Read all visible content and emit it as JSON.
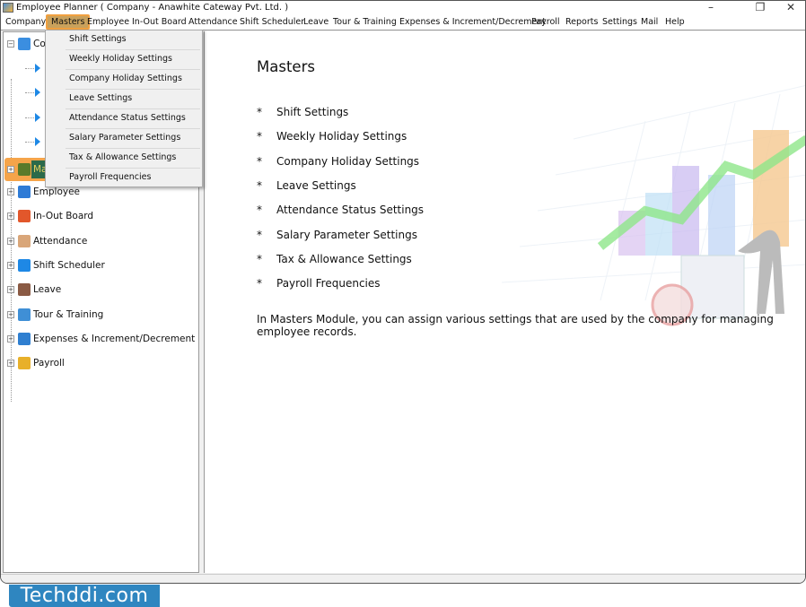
{
  "window": {
    "title": "Employee Planner ( Company - Anawhite Cateway Pvt. Ltd. )",
    "minimize": "–",
    "maximize": "❐",
    "close": "✕"
  },
  "menubar": [
    {
      "label": "Company"
    },
    {
      "label": "Masters",
      "active": true
    },
    {
      "label": "Employee"
    },
    {
      "label": "In-Out Board"
    },
    {
      "label": "Attendance"
    },
    {
      "label": "Shift Scheduler"
    },
    {
      "label": "Leave"
    },
    {
      "label": "Tour & Training"
    },
    {
      "label": "Expenses & Increment/Decrement"
    },
    {
      "label": "Payroll"
    },
    {
      "label": "Reports"
    },
    {
      "label": "Settings"
    },
    {
      "label": "Mail"
    },
    {
      "label": "Help"
    }
  ],
  "dropdown": [
    "Shift Settings",
    "Weekly Holiday Settings",
    "Company Holiday Settings",
    "Leave Settings",
    "Attendance Status Settings",
    "Salary Parameter Settings",
    "Tax & Allowance Settings",
    "Payroll Frequencies"
  ],
  "tree": {
    "company": "Com",
    "masters": "Ma",
    "items": [
      {
        "label": "Employee",
        "icon": "employee-icon",
        "color": "#2e7bd6"
      },
      {
        "label": "In-Out Board",
        "icon": "in-out-arrows-icon",
        "color": "#e2572b"
      },
      {
        "label": "Attendance",
        "icon": "attendance-clipboard-icon",
        "color": "#d9a679"
      },
      {
        "label": "Shift Scheduler",
        "icon": "shift-clock-icon",
        "color": "#1e88e5"
      },
      {
        "label": "Leave",
        "icon": "calendar-icon",
        "color": "#8a5a44"
      },
      {
        "label": "Tour & Training",
        "icon": "airplane-icon",
        "color": "#3f8fd6"
      },
      {
        "label": "Expenses & Increment/Decrement",
        "icon": "wallet-icon",
        "color": "#2f7fd0"
      },
      {
        "label": "Payroll",
        "icon": "dollar-coin-icon",
        "color": "#e8b02a"
      }
    ]
  },
  "main": {
    "title": "Masters",
    "bullet": "*",
    "items": [
      "Shift Settings",
      "Weekly Holiday Settings",
      "Company Holiday Settings",
      "Leave Settings",
      "Attendance Status Settings",
      "Salary Parameter Settings",
      "Tax & Allowance Settings",
      "Payroll Frequencies"
    ],
    "description": "In Masters Module, you can assign various settings that are used by the company for managing employee records."
  },
  "watermark": "Techddi.com",
  "colors": {
    "menu_active": "#c9a15c",
    "highlight": "#f0a040",
    "watermark_bg": "#2f86c0"
  }
}
